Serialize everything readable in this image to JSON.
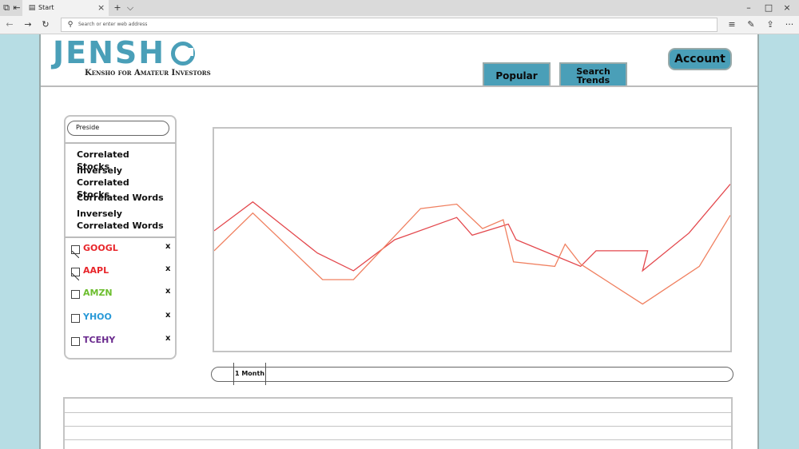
{
  "browser": {
    "tab_title": "Start",
    "tab_close": "×",
    "new_tab": "+",
    "tab_list": "⌵",
    "url_placeholder": "Search or enter web address",
    "nav_back": "←",
    "nav_forward": "→",
    "refresh": "↻",
    "win_min": "–",
    "win_max": "□",
    "win_close": "×",
    "hub": "≡",
    "notes": "✎",
    "share": "⇪",
    "more": "···"
  },
  "header": {
    "logo": "JENSH",
    "tagline": "Kensho for Amateur Investors",
    "nav": {
      "popular": "Popular",
      "trends": "Search Trends"
    },
    "account": "Account"
  },
  "sidebar": {
    "search_value": "Preside",
    "menu": [
      "Correlated Stocks",
      "Inversely Correlated Stocks",
      "Correlated Words",
      "Inversely Correlated Words"
    ],
    "tickers": [
      {
        "symbol": "GOOGL",
        "color": "#e8262b",
        "checked": true,
        "remove": "x"
      },
      {
        "symbol": "AAPL",
        "color": "#e8262b",
        "checked": true,
        "remove": "x"
      },
      {
        "symbol": "AMZN",
        "color": "#6cbe2e",
        "checked": false,
        "remove": "x"
      },
      {
        "symbol": "YHOO",
        "color": "#2a9ad8",
        "checked": false,
        "remove": "x"
      },
      {
        "symbol": "TCEHY",
        "color": "#6a2a8e",
        "checked": false,
        "remove": "x"
      }
    ]
  },
  "chart_data": {
    "type": "line",
    "title": "",
    "xlabel": "",
    "ylabel": "",
    "grid": false,
    "x": [
      0,
      1,
      2,
      3,
      4,
      5,
      6,
      7,
      8,
      9,
      10,
      11,
      12,
      13,
      14,
      15,
      16,
      17,
      18,
      19,
      20
    ],
    "ylim": [
      0,
      100
    ],
    "series": [
      {
        "color": "#e3474c",
        "points": [
          [
            0,
            54
          ],
          [
            7.5,
            67
          ],
          [
            20,
            44
          ],
          [
            27,
            36
          ],
          [
            35,
            50
          ],
          [
            47,
            60
          ],
          [
            50,
            52
          ],
          [
            57,
            57
          ],
          [
            58.5,
            50
          ],
          [
            71,
            38
          ],
          [
            74,
            45
          ],
          [
            84,
            45
          ],
          [
            83,
            36
          ],
          [
            92,
            53
          ],
          [
            100,
            75
          ]
        ]
      },
      {
        "color": "#f08060",
        "points": [
          [
            0,
            45
          ],
          [
            7.5,
            62
          ],
          [
            21,
            32
          ],
          [
            27,
            32
          ],
          [
            40,
            64
          ],
          [
            47,
            66
          ],
          [
            52,
            55
          ],
          [
            56,
            59
          ],
          [
            58,
            40
          ],
          [
            66,
            38
          ],
          [
            68,
            48
          ],
          [
            71,
            39
          ],
          [
            83,
            21
          ],
          [
            94,
            38
          ],
          [
            100,
            61
          ]
        ]
      }
    ]
  },
  "range_slider": {
    "label": "1 Month"
  }
}
